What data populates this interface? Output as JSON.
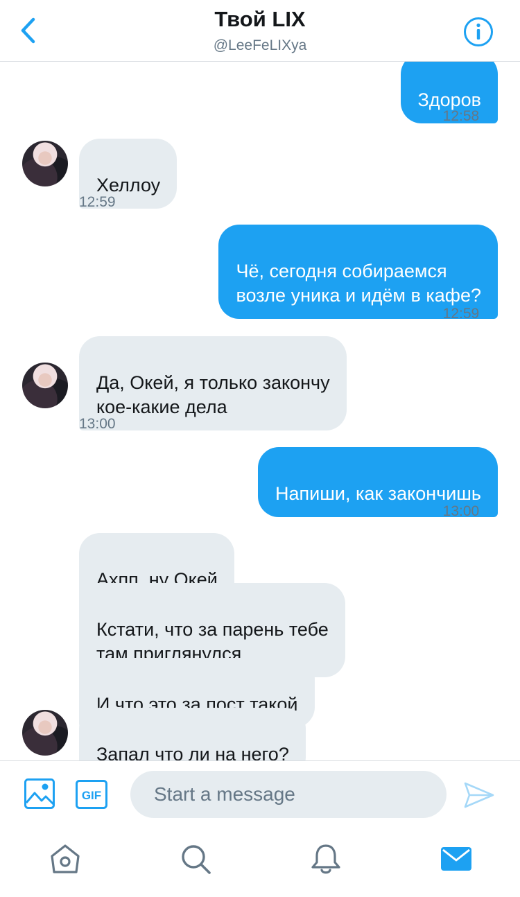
{
  "header": {
    "title": "Твой LIX",
    "handle": "@LeeFeLIXya"
  },
  "messages": [
    {
      "direction": "out",
      "text": "Здоров",
      "time": "12:58",
      "read": true
    },
    {
      "direction": "in",
      "text": "Хеллоу",
      "time": "12:59"
    },
    {
      "direction": "out",
      "text": "Чё, сегодня собираемся\nвозле уника и идём в кафе?",
      "time": "12:59",
      "read": true
    },
    {
      "direction": "in",
      "text": "Да, Окей, я только закончу\nкое-какие дела",
      "time": "13:00"
    },
    {
      "direction": "out",
      "text": "Напиши, как закончишь",
      "time": "13:00",
      "read": true
    },
    {
      "direction": "in",
      "text": "Ахпп, ну Окей"
    },
    {
      "direction": "in",
      "text": "Кстати, что за парень тебе\nтам приглянулся"
    },
    {
      "direction": "in",
      "text": "И что это за пост такой"
    },
    {
      "direction": "in",
      "text": "Запал что ли на него?"
    }
  ],
  "composer": {
    "placeholder": "Start a message",
    "gif_label": "GIF"
  },
  "read_mark": "✓",
  "colors": {
    "accent": "#1da1f2",
    "incoming_bubble": "#e6ecf0",
    "secondary_text": "#657786"
  },
  "icons": {
    "back": "chevron-left-icon",
    "info": "info-icon",
    "media": "image-icon",
    "send": "paper-plane-icon",
    "tabs": [
      "home-icon",
      "search-icon",
      "bell-icon",
      "mail-icon"
    ]
  },
  "tabbar": {
    "active": "messages"
  }
}
